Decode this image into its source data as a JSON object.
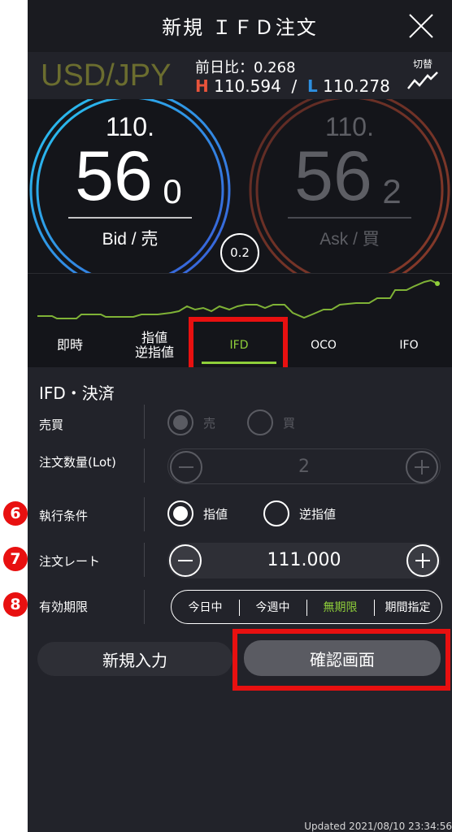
{
  "header": {
    "title": "新規 ＩＦＤ注文"
  },
  "pair": {
    "symbol": "USD/JPY",
    "change_label": "前日比：",
    "change_value": "0.268",
    "high_label": "H",
    "high_value": "110.594",
    "separator": "/",
    "low_label": "L",
    "low_value": "110.278",
    "switch_label": "切替"
  },
  "bid": {
    "prefix": "110.",
    "main": "56",
    "sub": "0",
    "label": "Bid / 売"
  },
  "ask": {
    "prefix": "110.",
    "main": "56",
    "sub": "2",
    "label": "Ask / 買"
  },
  "spread": "0.2",
  "tabs": [
    {
      "label": "即時"
    },
    {
      "label": "指値\n逆指値"
    },
    {
      "label": "IFD"
    },
    {
      "label": "OCO"
    },
    {
      "label": "IFO"
    }
  ],
  "form": {
    "section_title": "IFD・決済",
    "side": {
      "label": "売買",
      "sell": "売",
      "buy": "買"
    },
    "quantity": {
      "label": "注文数量(Lot)",
      "value": "2"
    },
    "condition": {
      "label": "執行条件",
      "limit": "指値",
      "stop": "逆指値",
      "badge": "6"
    },
    "rate": {
      "label": "注文レート",
      "value": "111.000",
      "badge": "7"
    },
    "expiry": {
      "label": "有効期限",
      "badge": "8",
      "options": [
        "今日中",
        "今週中",
        "無期限",
        "期間指定"
      ],
      "selected": "無期限"
    }
  },
  "buttons": {
    "new_input": "新規入力",
    "confirm": "確認画面"
  },
  "updated": "Updated  2021/08/10 23:34:56",
  "colors": {
    "accent": "#8fcf3a",
    "highlight_box": "#e81010",
    "high": "#e8533b",
    "low": "#2d8fe0"
  }
}
